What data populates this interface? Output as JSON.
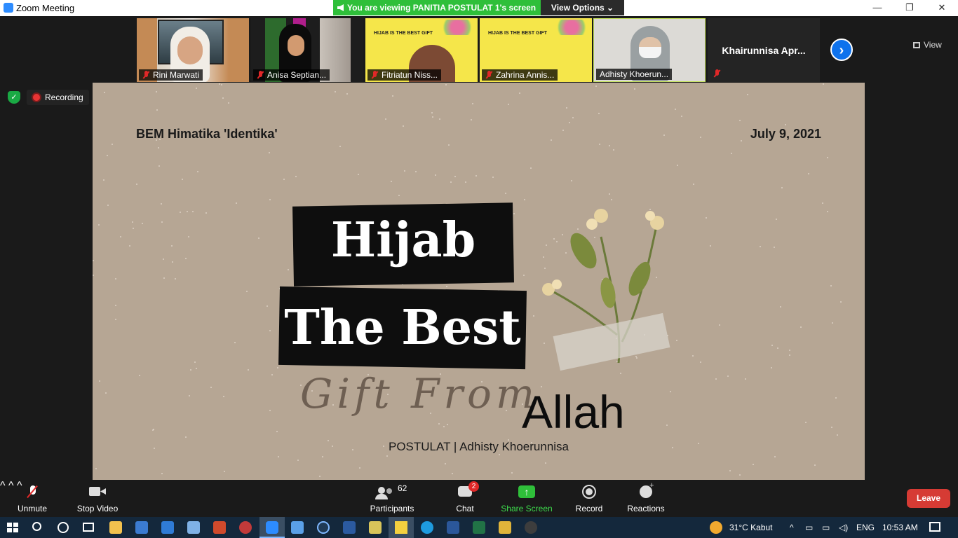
{
  "window": {
    "title": "Zoom Meeting",
    "minimize": "—",
    "restore": "❐",
    "close": "✕"
  },
  "banner": {
    "viewing": "You are viewing PANITIA POSTULAT 1's screen",
    "view_options": "View Options ⌄"
  },
  "participants_strip": {
    "thumbs": [
      {
        "name": "Rini Marwati"
      },
      {
        "name": "Anisa Septian..."
      },
      {
        "name": "Fitriatun Niss..."
      },
      {
        "name": "Zahrina Annis..."
      },
      {
        "name": "Adhisty Khoerun..."
      },
      {
        "name": "Khairunnisa  Apr..."
      }
    ],
    "next_label": "›",
    "view_label": "View"
  },
  "recording": {
    "label": "Recording"
  },
  "slide": {
    "org": "BEM Himatika 'Identika'",
    "date": "July 9, 2021",
    "line1": "Hijab",
    "line2": "The Best",
    "script": "Gift From",
    "allah": "Allah",
    "byline": "POSTULAT | Adhisty Khoerunnisa"
  },
  "toolbar": {
    "unmute": "Unmute",
    "stop_video": "Stop Video",
    "participants": "Participants",
    "participants_count": "62",
    "chat": "Chat",
    "chat_badge": "2",
    "share_screen": "Share Screen",
    "record": "Record",
    "reactions": "Reactions",
    "leave": "Leave"
  },
  "taskbar": {
    "weather": "31°C  Kabut",
    "lang": "ENG",
    "time": "10:53 AM"
  },
  "colors": {
    "share_green": "#2fbf3a",
    "leave_red": "#d63b34",
    "zoom_blue": "#0e72ed",
    "taskbar": "#14283c"
  }
}
